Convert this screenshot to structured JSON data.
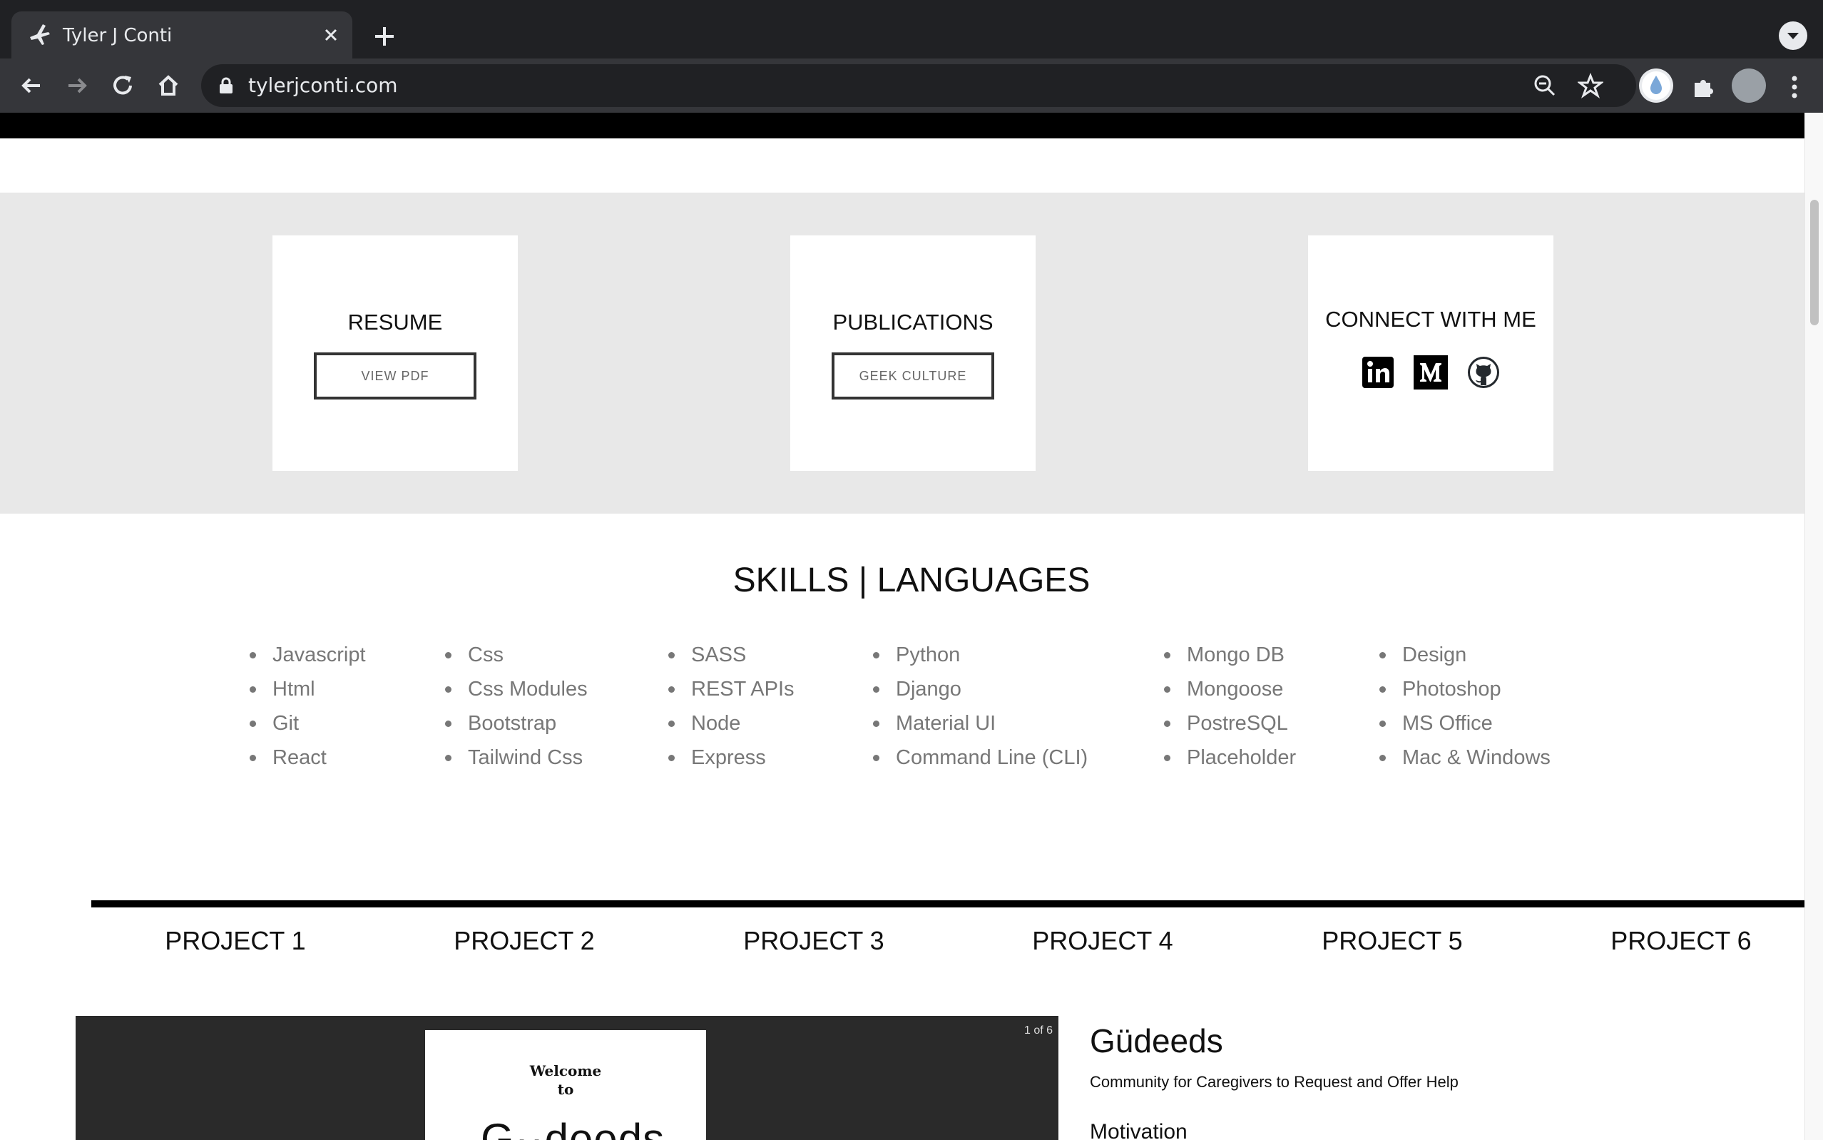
{
  "browser": {
    "tab_title": "Tyler J Conti",
    "url": "tylerjconti.com"
  },
  "cards": {
    "resume": {
      "title": "RESUME",
      "button": "VIEW PDF"
    },
    "publications": {
      "title": "PUBLICATIONS",
      "button": "GEEK CULTURE"
    },
    "connect": {
      "title": "CONNECT WITH ME"
    }
  },
  "skills": {
    "title": "SKILLS | LANGUAGES",
    "columns": [
      [
        "Javascript",
        "Html",
        "Git",
        "React"
      ],
      [
        "Css",
        "Css Modules",
        "Bootstrap",
        "Tailwind Css"
      ],
      [
        "SASS",
        "REST APIs",
        "Node",
        "Express"
      ],
      [
        "Python",
        "Django",
        "Material UI",
        "Command Line (CLI)"
      ],
      [
        "Mongo DB",
        "Mongoose",
        "PostreSQL",
        "Placeholder"
      ],
      [
        "Design",
        "Photoshop",
        "MS Office",
        "Mac & Windows"
      ]
    ]
  },
  "projects": {
    "tabs": [
      "PROJECT 1",
      "PROJECT 2",
      "PROJECT 3",
      "PROJECT 4",
      "PROJECT 5",
      "PROJECT 6"
    ],
    "viewer_counter": "1 of 6",
    "slide_welcome": "Welcome",
    "slide_to": "to",
    "slide_logo": "G··deeds",
    "name": "Güdeeds",
    "subtitle": "Community for Caregivers to Request and Offer Help",
    "section_heading": "Motivation"
  }
}
